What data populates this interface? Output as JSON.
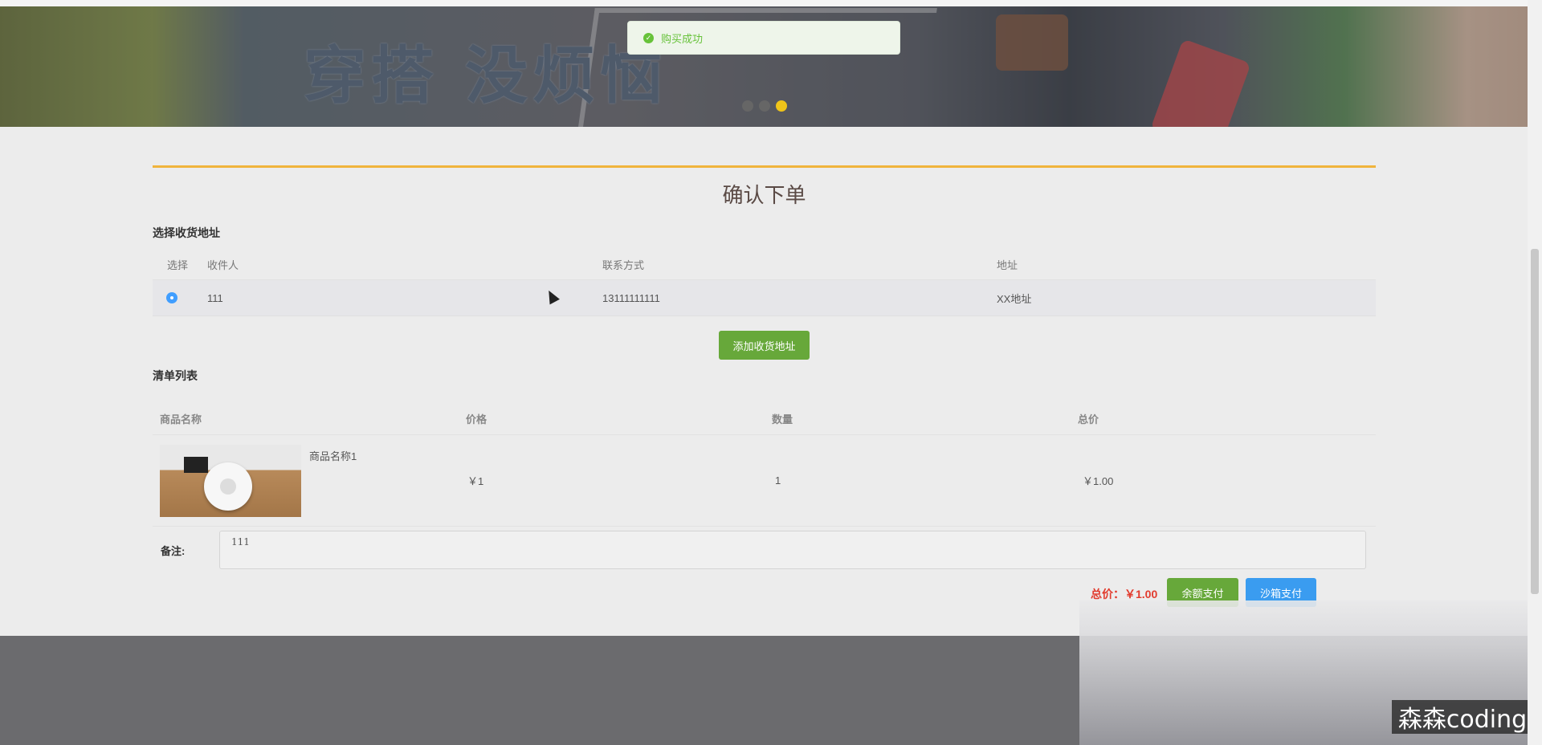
{
  "toast": {
    "message": "购买成功",
    "icon": "check-circle-icon",
    "color": "#67c23a"
  },
  "banner": {
    "slogan": "穿搭 没烦恼",
    "active_slide": 3,
    "total_slides": 3
  },
  "page": {
    "title": "确认下单"
  },
  "address_section": {
    "title": "选择收货地址",
    "columns": {
      "select": "选择",
      "recipient": "收件人",
      "contact": "联系方式",
      "address": "地址"
    },
    "rows": [
      {
        "recipient": "111",
        "contact": "13111111111",
        "address": "XX地址",
        "selected": true
      }
    ],
    "add_button": "添加收货地址"
  },
  "list_section": {
    "title": "清单列表",
    "columns": {
      "name": "商品名称",
      "price": "价格",
      "quantity": "数量",
      "total": "总价"
    },
    "items": [
      {
        "name": "商品名称1",
        "price": "￥1",
        "quantity": "1",
        "total": "￥1.00"
      }
    ]
  },
  "remark": {
    "label": "备注:",
    "value": "111"
  },
  "summary": {
    "total": "总价：￥1.00",
    "balance_pay": "余额支付",
    "sandbox_pay": "沙箱支付"
  },
  "watermark": "森森coding",
  "colors": {
    "accent_gold": "#f0b43c",
    "green": "#67a83a",
    "blue": "#3a9cf0",
    "price_red": "#e23b2d"
  }
}
